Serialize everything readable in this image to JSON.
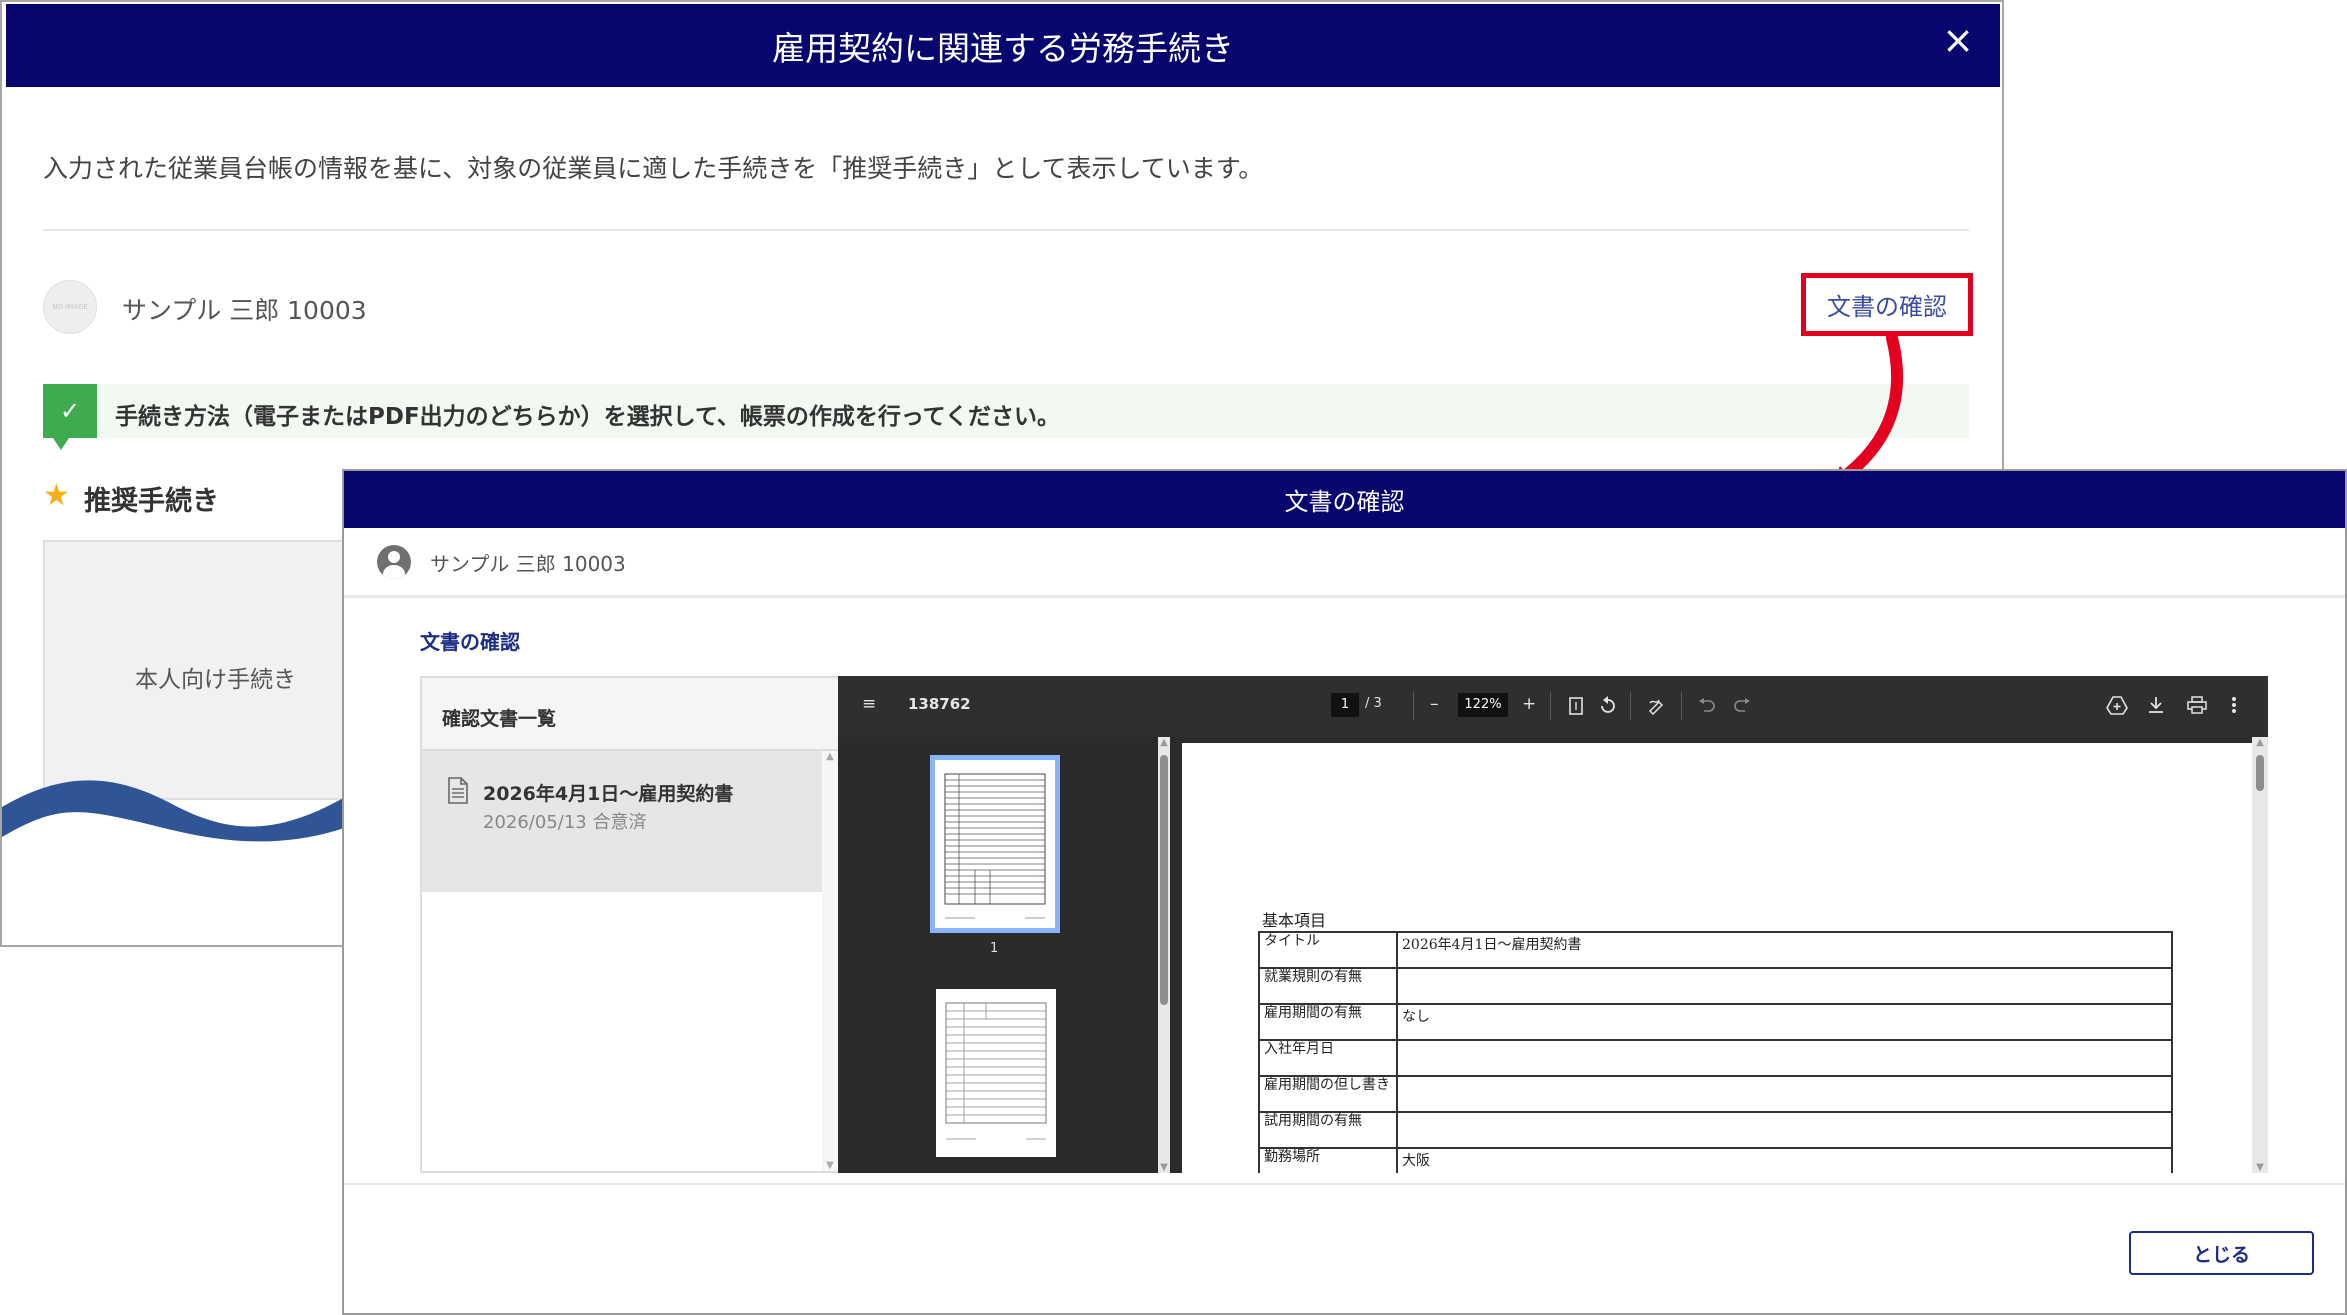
{
  "back_dialog": {
    "title": "雇用契約に関連する労務手続き",
    "close": "×",
    "intro": "入力された従業員台帳の情報を基に、対象の従業員に適した手続きを「推奨手続き」として表示しています。",
    "avatar_text": "NO IMAGE",
    "employee": "サンプル 三郎  10003",
    "doc_link": "文書の確認",
    "notice_icon": "✓",
    "notice": "手続き方法（電子またはPDF出力のどちらか）を選択して、帳票の作成を行ってください。",
    "star_icon": "★",
    "recommended_title": "推奨手続き",
    "card_label": "本人向け手続き"
  },
  "front_dialog": {
    "title": "文書の確認",
    "employee": "サンプル 三郎  10003",
    "section_title": "文書の確認",
    "list": {
      "header": "確認文書一覧",
      "items": [
        {
          "title": "2026年4月1日～雇用契約書",
          "status": "2026/05/13 合意済"
        }
      ]
    },
    "viewer": {
      "menu_icon": "≡",
      "file_name": "138762",
      "page_current": "1",
      "page_total": "/ 3",
      "zoom_out": "–",
      "zoom": "122%",
      "zoom_in": "+",
      "thumb_label": "1",
      "page": {
        "section": "基本項目",
        "rows": [
          {
            "key": "タイトル",
            "value": "2026年4月1日～雇用契約書"
          },
          {
            "key": "就業規則の有無",
            "value": ""
          },
          {
            "key": "雇用期間の有無",
            "value": "なし"
          },
          {
            "key": "入社年月日",
            "value": ""
          },
          {
            "key": "雇用期間の但し書き",
            "value": ""
          },
          {
            "key": "試用期間の有無",
            "value": ""
          },
          {
            "key": "勤務場所",
            "value": "大阪"
          }
        ]
      }
    },
    "close_button": "とじる"
  },
  "colors": {
    "header_navy": "#06066e",
    "highlight_red": "#e4001e",
    "notice_green": "#3fab4f",
    "link_blue": "#1c2d84",
    "wave_blue": "#2f5597"
  }
}
